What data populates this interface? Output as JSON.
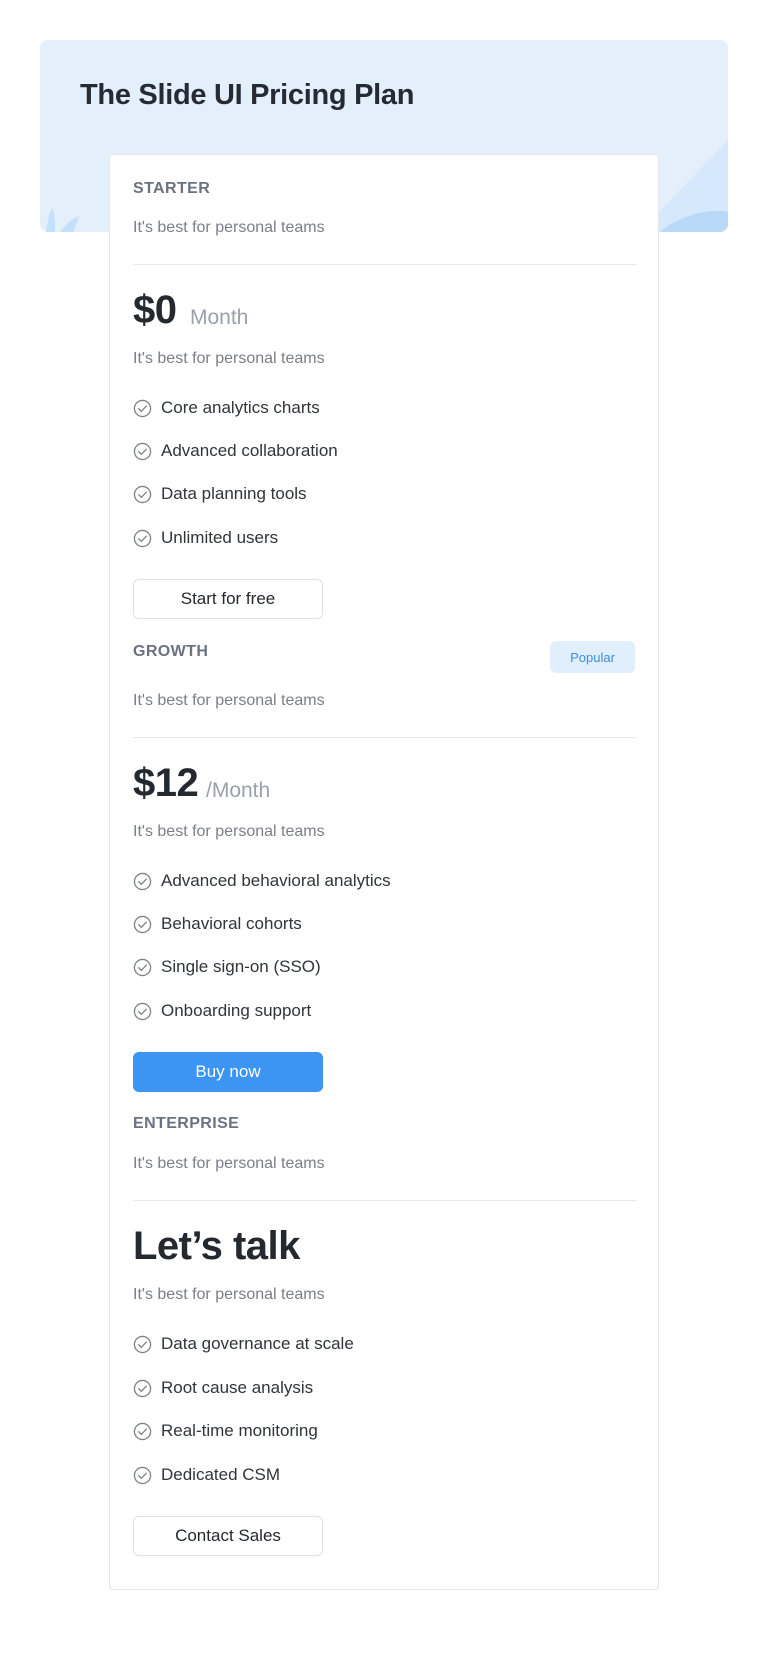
{
  "page": {
    "title": "The Slide UI Pricing Plan"
  },
  "colors": {
    "hero_bg": "#e3f0fc",
    "primary": "#3d95f3",
    "badge_bg": "#e1effc",
    "badge_text": "#3f8fd8",
    "muted_text": "#7a7f87"
  },
  "plans": [
    {
      "name": "STARTER",
      "tagline": "It's best for personal teams",
      "price": "$0",
      "period": "Month",
      "description": "It's best for personal teams",
      "features": [
        "Core analytics charts",
        "Advanced collaboration",
        "Data planning tools",
        "Unlimited users"
      ],
      "cta": "Start for free"
    },
    {
      "name": "GROWTH",
      "badge": "Popular",
      "tagline": "It's best for personal teams",
      "price": "$12",
      "period": "/Month",
      "description": "It's best for personal teams",
      "features": [
        "Advanced behavioral analytics",
        "Behavioral cohorts",
        "Single sign-on (SSO)",
        "Onboarding support"
      ],
      "cta": "Buy now"
    },
    {
      "name": "ENTERPRISE",
      "tagline": "It's best for personal teams",
      "price": "Let’s talk",
      "description": "It's best for personal teams",
      "features": [
        "Data governance at scale",
        "Root cause analysis",
        "Real-time monitoring",
        "Dedicated CSM"
      ],
      "cta": "Contact Sales"
    }
  ],
  "icons": {
    "feature_check": "check-circle-icon"
  }
}
